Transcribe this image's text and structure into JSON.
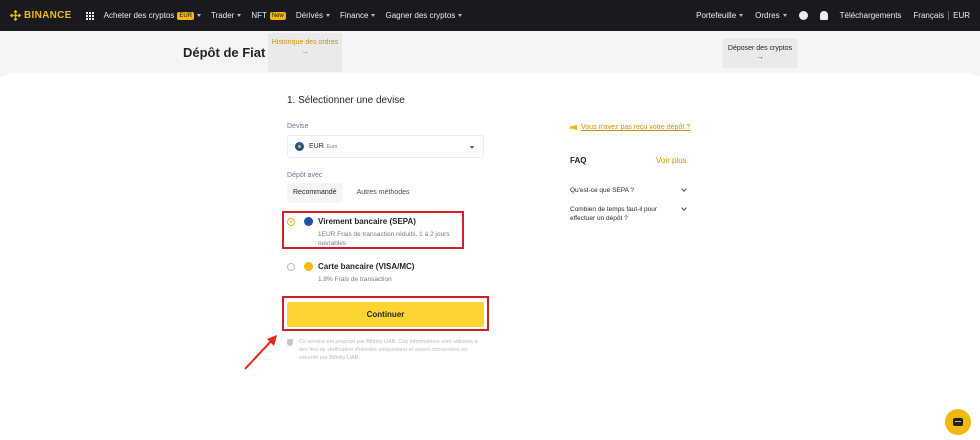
{
  "brand": {
    "name": "BINANCE",
    "accent": "#f0b90b"
  },
  "topnav": {
    "items": [
      {
        "label": "Acheter des cryptos",
        "tag": "EUR"
      },
      {
        "label": "Trader"
      },
      {
        "label": "NFT",
        "tag": "New"
      },
      {
        "label": "Dérivés"
      },
      {
        "label": "Finance"
      },
      {
        "label": "Gagner des cryptos"
      }
    ],
    "right": {
      "portfolio": "Portefeuille",
      "orders": "Ordres",
      "downloads": "Téléchargements",
      "language": "Français",
      "currency": "EUR"
    }
  },
  "header": {
    "title": "Dépôt de Fiat",
    "history_button": "Historique des ordres",
    "history_arrow": "→",
    "deposit_crypto_button": "Déposer des cryptos",
    "deposit_crypto_arrow": "→"
  },
  "form": {
    "step_title": "1. Sélectionner une devise",
    "currency_label": "Devise",
    "currency_code": "EUR",
    "currency_name": "Euro",
    "deposit_with_label": "Dépôt avec",
    "tabs": [
      {
        "label": "Recommandé",
        "active": true
      },
      {
        "label": "Autres méthodes",
        "active": false
      }
    ],
    "options": [
      {
        "title": "Virement bancaire (SEPA)",
        "desc": "1EUR Frais de transaction réduits, 1 à 2 jours ouvrables",
        "selected": true
      },
      {
        "title": "Carte bancaire (VISA/MC)",
        "desc": "1.8% Frais de transaction",
        "selected": false
      }
    ],
    "continue_label": "Continuer",
    "disclaimer": "Ce service est proposé par Bifinity UAB. Ces informations sont utilisées à des fins de vérification d'identité uniquement et seront conservées en sécurité par Bifinity UAB."
  },
  "sidebar": {
    "not_received_link": "Vous n'avez pas reçu votre dépôt ?",
    "faq_title": "FAQ",
    "faq_more": "Voir plus",
    "faq_items": [
      "Qu'est-ce que SEPA ?",
      "Combien de temps faut-il pour effectuer un dépôt ?"
    ]
  },
  "icons": {
    "logo": "binance-logo-icon",
    "apps": "grid-icon",
    "user": "user-icon",
    "notifications": "bell-icon",
    "chat": "chat-icon"
  }
}
